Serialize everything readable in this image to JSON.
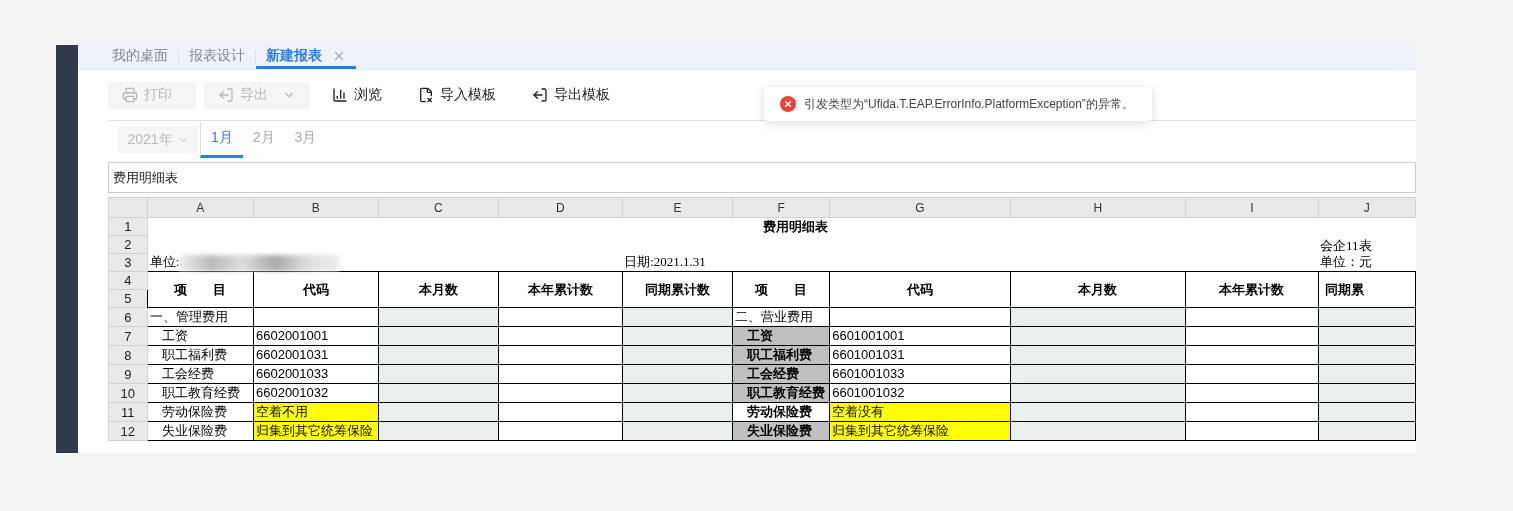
{
  "tabs": [
    {
      "label": "我的桌面",
      "selected": false,
      "closable": false
    },
    {
      "label": "报表设计",
      "selected": false,
      "closable": false
    },
    {
      "label": "新建报表",
      "selected": true,
      "closable": true
    }
  ],
  "toolbar": [
    {
      "kind": "printer",
      "label": "打印",
      "disabled": true,
      "dropdown": false
    },
    {
      "kind": "export",
      "label": "导出",
      "disabled": true,
      "dropdown": true
    },
    {
      "kind": "browse",
      "label": "浏览",
      "disabled": false,
      "dropdown": false
    },
    {
      "kind": "import",
      "label": "导入模板",
      "disabled": false,
      "dropdown": false
    },
    {
      "kind": "export",
      "label": "导出模板",
      "disabled": false,
      "dropdown": false
    }
  ],
  "error_toast": {
    "message": "引发类型为“Ufida.T.EAP.ErrorInfo.PlatformException”的异常。"
  },
  "period": {
    "year": "2021年",
    "months": [
      {
        "label": "1月",
        "selected": true
      },
      {
        "label": "2月",
        "selected": false
      },
      {
        "label": "3月",
        "selected": false
      }
    ]
  },
  "formula_bar": {
    "value": "费用明细表"
  },
  "sheet": {
    "columns": [
      "A",
      "B",
      "C",
      "D",
      "E",
      "F",
      "G",
      "H",
      "I",
      "J"
    ],
    "rows": [
      "1",
      "2",
      "3",
      "4",
      "5",
      "6",
      "7",
      "8",
      "9",
      "10",
      "11",
      "12"
    ],
    "title": "费用明细表",
    "unit_label": "单位:",
    "date": "日期:2021.1.31",
    "form_no": "会企11表",
    "currency_unit": "单位：元",
    "blocks": [
      {
        "headers": [
          "项　　目",
          "代码",
          "本月数",
          "本年累计数",
          "同期累计数"
        ],
        "section": "一、管理费用",
        "items": [
          {
            "name": "工资",
            "code": "6602001001",
            "highlighted": false,
            "shaded": false
          },
          {
            "name": "职工福利费",
            "code": "6602001031",
            "highlighted": false,
            "shaded": false
          },
          {
            "name": "工会经费",
            "code": "6602001033",
            "highlighted": false,
            "shaded": false
          },
          {
            "name": "职工教育经费",
            "code": "6602001032",
            "highlighted": false,
            "shaded": false
          },
          {
            "name": "劳动保险费",
            "code": "空着不用",
            "highlighted": true,
            "shaded": false
          },
          {
            "name": "失业保险费",
            "code": "归集到其它统筹保险",
            "highlighted": true,
            "shaded": false
          }
        ]
      },
      {
        "headers": [
          "项　　目",
          "代码",
          "本月数",
          "本年累计数",
          "同期累"
        ],
        "section": "二、营业费用",
        "items": [
          {
            "name": "工资",
            "code": "6601001001",
            "highlighted": false,
            "shaded": true
          },
          {
            "name": "职工福利费",
            "code": "6601001031",
            "highlighted": false,
            "shaded": true
          },
          {
            "name": "工会经费",
            "code": "6601001033",
            "highlighted": false,
            "shaded": true
          },
          {
            "name": "职工教育经费",
            "code": "6601001032",
            "highlighted": false,
            "shaded": true
          },
          {
            "name": "劳动保险费",
            "code": "空着没有",
            "highlighted": true,
            "shaded": false
          },
          {
            "name": "失业保险费",
            "code": "归集到其它统筹保险",
            "highlighted": true,
            "shaded": true
          }
        ]
      }
    ]
  }
}
